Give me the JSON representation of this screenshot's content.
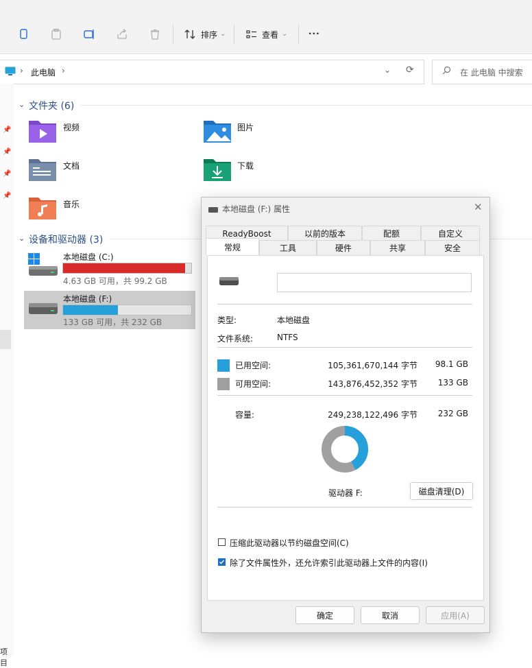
{
  "toolbar": {
    "sort_label": "排序",
    "view_label": "查看",
    "more_label": "···"
  },
  "address": {
    "location": "此电脑",
    "separator": "›",
    "search_placeholder": "在 此电脑 中搜索"
  },
  "folders": {
    "header": "文件夹 (6)",
    "items": [
      {
        "label": "视频",
        "icon": "videos-folder-icon"
      },
      {
        "label": "图片",
        "icon": "pictures-folder-icon"
      },
      {
        "label": "文档",
        "icon": "documents-folder-icon"
      },
      {
        "label": "下载",
        "icon": "downloads-folder-icon"
      },
      {
        "label": "音乐",
        "icon": "music-folder-icon"
      }
    ]
  },
  "drives": {
    "header": "设备和驱动器 (3)",
    "items": [
      {
        "name": "本地磁盘 (C:)",
        "detail": "4.63 GB 可用，共 99.2 GB",
        "used_fraction": 0.953,
        "bar_color": "#da2b2b"
      },
      {
        "name": "本地磁盘 (F:)",
        "detail": "133 GB 可用，共 232 GB",
        "used_fraction": 0.427,
        "bar_color": "#26a0da"
      }
    ]
  },
  "bottom_left_fragment": "项目",
  "dialog": {
    "title": "本地磁盘 (F:) 属性",
    "tabs_row1": [
      "ReadyBoost",
      "以前的版本",
      "配额",
      "自定义"
    ],
    "tabs_row2": [
      "常规",
      "工具",
      "硬件",
      "共享",
      "安全"
    ],
    "active_tab": "常规",
    "name_field_value": "",
    "type_label": "类型:",
    "type_value": "本地磁盘",
    "fs_label": "文件系统:",
    "fs_value": "NTFS",
    "used_label": "已用空间:",
    "used_bytes": "105,361,670,144 字节",
    "used_size": "98.1 GB",
    "free_label": "可用空间:",
    "free_bytes": "143,876,452,352 字节",
    "free_size": "133 GB",
    "capacity_label": "容量:",
    "capacity_bytes": "249,238,122,496 字节",
    "capacity_size": "232 GB",
    "drive_label": "驱动器 F:",
    "cleanup_button": "磁盘清理(D)",
    "compress_label": "压缩此驱动器以节约磁盘空间(C)",
    "compress_checked": false,
    "index_label": "除了文件属性外，还允许索引此驱动器上文件的内容(I)",
    "index_checked": true,
    "ok_button": "确定",
    "cancel_button": "取消",
    "apply_button": "应用(A)",
    "used_color": "#26a0da",
    "free_color": "#a0a0a0",
    "used_fraction": 0.4227
  }
}
